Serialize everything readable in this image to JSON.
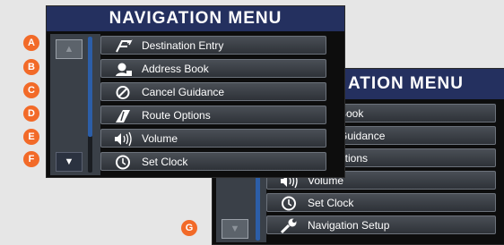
{
  "front": {
    "title": "NAVIGATION MENU",
    "items": [
      {
        "label": "Destination Entry",
        "icon": "destination-entry-icon"
      },
      {
        "label": "Address Book",
        "icon": "address-book-icon"
      },
      {
        "label": "Cancel Guidance",
        "icon": "cancel-guidance-icon"
      },
      {
        "label": "Route Options",
        "icon": "route-options-icon"
      },
      {
        "label": "Volume",
        "icon": "volume-icon"
      },
      {
        "label": "Set Clock",
        "icon": "clock-icon"
      }
    ],
    "scroll_up": "▲",
    "scroll_down": "▼"
  },
  "back": {
    "title_partial": "ATION MENU",
    "items": [
      {
        "label": "Book"
      },
      {
        "label": "Guidance"
      },
      {
        "label": "ptions"
      },
      {
        "label": "Volume",
        "icon": "volume-icon"
      },
      {
        "label": "Set Clock",
        "icon": "clock-icon"
      },
      {
        "label": "Navigation Setup",
        "icon": "wrench-icon"
      }
    ],
    "scroll_down": "▼"
  },
  "callouts": [
    "A",
    "B",
    "C",
    "D",
    "E",
    "F",
    "G"
  ],
  "colors": {
    "title_bar": "#24305f",
    "badge": "#f26a28",
    "scroll_thumb": "#2c5ea8"
  }
}
